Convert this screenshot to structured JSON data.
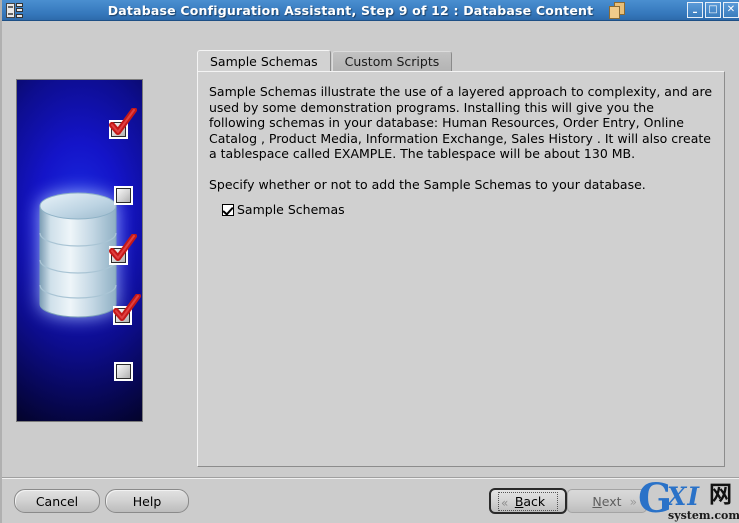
{
  "window": {
    "title": "Database Configuration Assistant, Step 9 of 12 : Database Content",
    "app_icon": "database-wizard-icon",
    "doc_icon": "documents-icon",
    "controls": {
      "minimize": "–",
      "maximize": "□",
      "close": "✕"
    }
  },
  "sidepanel": {
    "icon": "database-cylinder-icon",
    "checkmarks": [
      {
        "name": "step-marker-1",
        "checked": true
      },
      {
        "name": "step-marker-2",
        "checked": false
      },
      {
        "name": "step-marker-3",
        "checked": true
      },
      {
        "name": "step-marker-4",
        "checked": true
      },
      {
        "name": "step-marker-5",
        "checked": false
      }
    ]
  },
  "tabs": [
    {
      "label": "Sample Schemas",
      "selected": true
    },
    {
      "label": "Custom Scripts",
      "selected": false
    }
  ],
  "content": {
    "paragraph1": "Sample Schemas illustrate the use of a layered approach to complexity, and are used by some demonstration programs. Installing this will give you the following schemas in your database: Human Resources, Order Entry, Online Catalog , Product Media, Information Exchange, Sales History . It will also create a tablespace called EXAMPLE. The tablespace will be about 130 MB.",
    "paragraph2": "Specify whether or not to add the Sample Schemas to your database.",
    "checkbox": {
      "label": "Sample Schemas",
      "checked": true
    }
  },
  "buttons": {
    "cancel": "Cancel",
    "help": "Help",
    "back": "Back",
    "next": "Next",
    "back_arrow": "«",
    "next_arrow": "»"
  },
  "watermark": {
    "g": "G",
    "xi": "XI",
    "cjk": "网",
    "domain": "system.com"
  },
  "colors": {
    "titlebar": "#3b7fc4",
    "window_bg": "#cccccc",
    "panel_bg": "#d0d0d0",
    "sidepanel_blue": "#1414c8",
    "checkmark_red": "#c41818",
    "watermark_blue": "#2a72c8"
  }
}
